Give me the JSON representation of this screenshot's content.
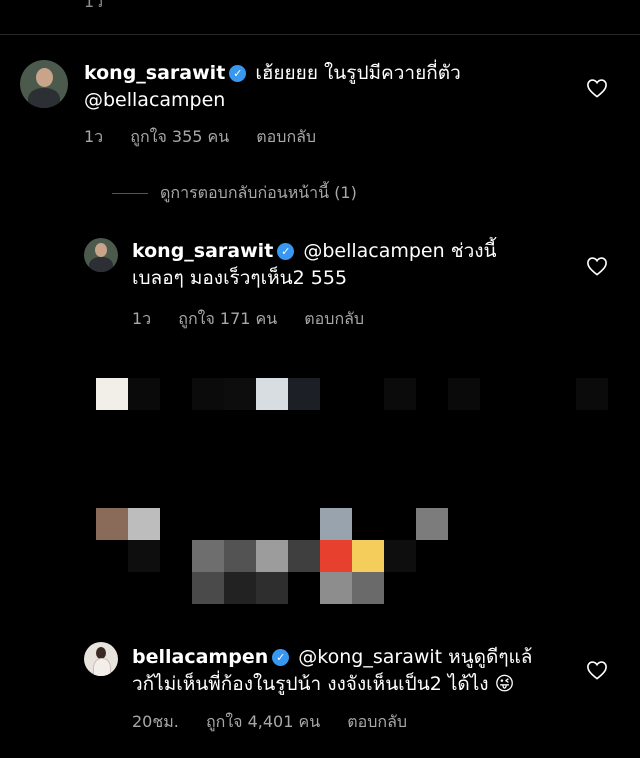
{
  "top_meta": {
    "time": "1ว"
  },
  "comment1": {
    "username": "kong_sarawit",
    "verified_glyph": "✓",
    "text_line1": "เฮ้ยยยย ในรูปมีควายกี่ตัว",
    "text_line2": "@bellacampen",
    "time": "1ว",
    "likes": "ถูกใจ 355 คน",
    "reply": "ตอบกลับ"
  },
  "view_previous": "ดูการตอบกลับก่อนหน้านี้ (1)",
  "reply1": {
    "username": "kong_sarawit",
    "verified_glyph": "✓",
    "text_line1": "@bellacampen ช่วงนี้",
    "text_line2": "เบลอๆ มองเร็วๆเห็น2 555",
    "time": "1ว",
    "likes": "ถูกใจ 171 คน",
    "reply": "ตอบกลับ"
  },
  "reply2": {
    "username": "bellacampen",
    "verified_glyph": "✓",
    "text_line1": "@kong_sarawit หนูดูดีๆแล้",
    "text_line2": "วก้ไม่เห็นพี่ก้องในรูปน้า งงจังเห็นเป็น2 ได้ไง",
    "emoji": "😜",
    "time": "20ชม.",
    "likes": "ถูกใจ 4,401 คน",
    "reply": "ตอบกลับ"
  },
  "icons": {
    "like": "heart-outline-icon",
    "verified": "verified-badge-icon"
  },
  "colors": {
    "background": "#000000",
    "verified": "#3897f0",
    "meta": "#a8a8a8"
  }
}
